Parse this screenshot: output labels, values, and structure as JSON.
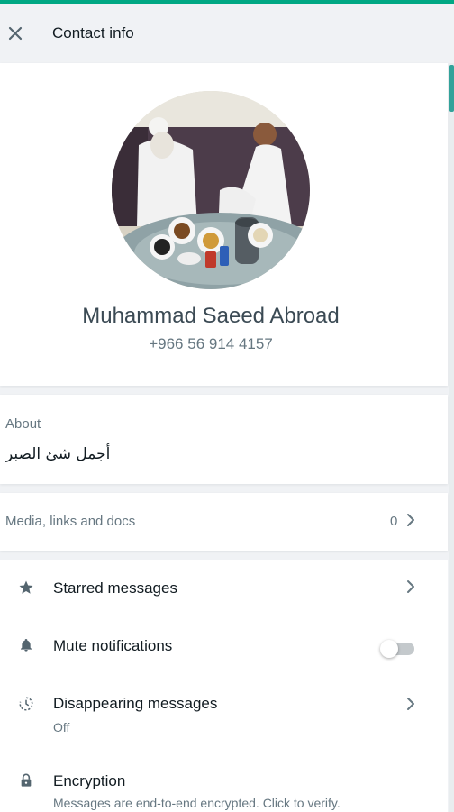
{
  "header": {
    "title": "Contact info"
  },
  "profile": {
    "name": "Muhammad Saeed Abroad",
    "phone": "+966 56 914 4157"
  },
  "about": {
    "label": "About",
    "text": "أجمل شئ الصبر"
  },
  "media": {
    "label": "Media, links and docs",
    "count": "0"
  },
  "options": [
    {
      "icon": "star-icon",
      "label": "Starred messages"
    },
    {
      "icon": "bell-icon",
      "label": "Mute notifications",
      "toggle_on": false
    },
    {
      "icon": "disappearing-timer-icon",
      "label": "Disappearing messages",
      "sub": "Off"
    },
    {
      "icon": "lock-icon",
      "label": "Encryption",
      "sub": "Messages are end-to-end encrypted. Click to verify."
    }
  ],
  "colors": {
    "accent": "#00a884",
    "panel_bg": "#f0f2f5",
    "text_primary": "#111b21",
    "text_secondary": "#667781"
  }
}
